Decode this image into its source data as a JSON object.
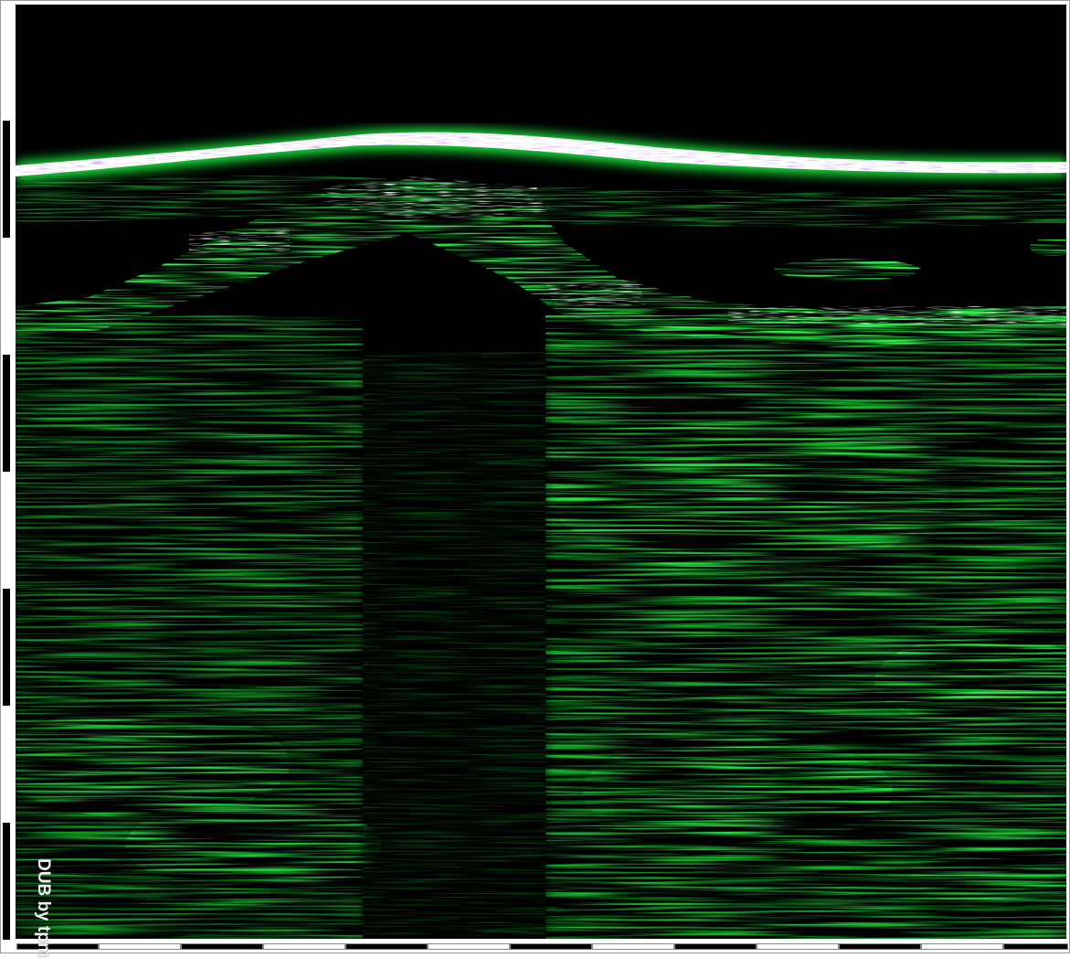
{
  "image": {
    "kind": "b-mode ultrasound style scan rendered in green intensity",
    "background": "#000000",
    "tissue_color": "#1fd63a",
    "highlight_color": "#ffffff",
    "frame_color": "#9a9a9a"
  },
  "watermark": {
    "text": "DUB by tpm"
  },
  "scales": {
    "vertical_segments": 8,
    "horizontal_segments": 13,
    "dark_color": "#000000",
    "light_color": "#ffffff"
  }
}
